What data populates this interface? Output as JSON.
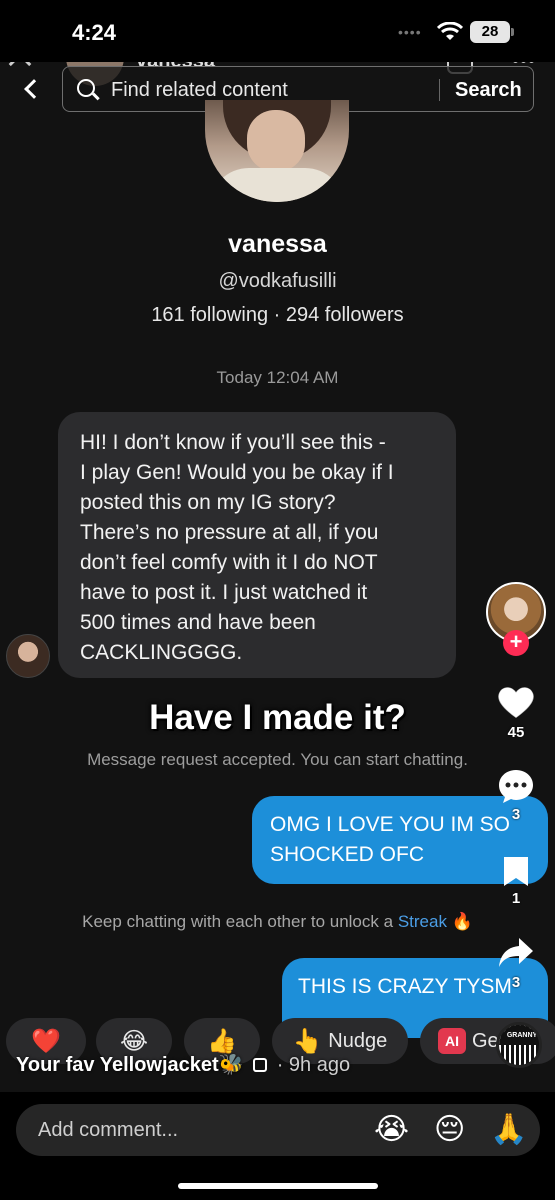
{
  "status_bar": {
    "time": "4:24",
    "battery": "28"
  },
  "header": {
    "name_partial": "vanessa",
    "search_placeholder": "Find related content",
    "search_button": "Search"
  },
  "profile": {
    "name": "vanessa",
    "handle": "@vodkafusilli",
    "stats": "161 following · 294 followers"
  },
  "chat": {
    "timestamp": "Today 12:04 AM",
    "incoming_lines": [
      "HI! I don’t know if you’ll see this -",
      "I play Gen! Would you be okay if I",
      "posted this on my IG story?",
      "There’s no pressure at all, if you",
      "don’t feel comfy with it I do NOT",
      "have to post it. I just watched it",
      "500 times and have been",
      "CACKLINGGGG."
    ],
    "overlay_caption": "Have I made it?",
    "system_message": "Message request accepted. You can start chatting.",
    "outgoing_1_lines": [
      "OMG I LOVE YOU IM SO",
      "SHOCKED OFC"
    ],
    "streak_prefix": "Keep chatting with each other to unlock a",
    "streak_link": "Streak",
    "streak_emoji": "🔥",
    "outgoing_2": "THIS IS CRAZY TYSM"
  },
  "reactions": {
    "heart": "❤️",
    "laugh": "😂",
    "thumbs": "👍",
    "nudge_emoji": "👆",
    "nudge_label": "Nudge",
    "ai_tag": "AI",
    "ai_label": "Gen"
  },
  "rail": {
    "likes": "45",
    "comments": "3",
    "saves": "1",
    "shares": "3",
    "disc_label": "GRANNY"
  },
  "video": {
    "author": "Your fav Yellowjacket",
    "author_emoji": "🐝",
    "ago": "· 9h ago"
  },
  "comment_bar": {
    "placeholder": "Add comment...",
    "emojis": [
      "😭",
      "😔",
      "🙏"
    ]
  }
}
